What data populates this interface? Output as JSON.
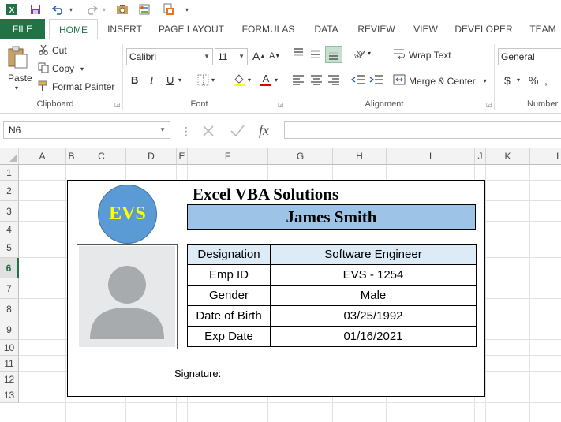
{
  "ribbon_tabs": [
    "FILE",
    "HOME",
    "INSERT",
    "PAGE LAYOUT",
    "FORMULAS",
    "DATA",
    "REVIEW",
    "VIEW",
    "DEVELOPER",
    "TEAM"
  ],
  "ribbon": {
    "clipboard": {
      "paste": "Paste",
      "cut": "Cut",
      "copy": "Copy",
      "format_painter": "Format Painter",
      "label": "Clipboard"
    },
    "font": {
      "name": "Calibri",
      "size": "11",
      "bold": "B",
      "italic": "I",
      "underline": "U",
      "label": "Font"
    },
    "alignment": {
      "wrap_text": "Wrap Text",
      "merge_center": "Merge & Center",
      "label": "Alignment"
    },
    "number": {
      "format": "General",
      "currency": "$",
      "percent": "%",
      "label": "Number"
    }
  },
  "formula_bar": {
    "name_box": "N6",
    "fx": "fx",
    "formula": ""
  },
  "columns": [
    "A",
    "B",
    "C",
    "D",
    "E",
    "F",
    "G",
    "H",
    "I",
    "J",
    "K",
    "L"
  ],
  "rows": [
    "1",
    "2",
    "3",
    "4",
    "5",
    "6",
    "7",
    "8",
    "9",
    "10",
    "11",
    "12",
    "13"
  ],
  "selected_row": "6",
  "card": {
    "logo_text": "EVS",
    "company": "Excel VBA Solutions",
    "employee_name": "James Smith",
    "fields": [
      {
        "label": "Designation",
        "value": "Software Engineer"
      },
      {
        "label": "Emp ID",
        "value": "EVS - 1254"
      },
      {
        "label": "Gender",
        "value": "Male"
      },
      {
        "label": "Date of Birth",
        "value": "03/25/1992"
      },
      {
        "label": "Exp Date",
        "value": "01/16/2021"
      }
    ],
    "signature_label": "Signature:"
  },
  "colors": {
    "excel_green": "#217346",
    "logo_fill": "#5b9bd5",
    "logo_text": "#ffff00",
    "name_banner": "#9dc3e6",
    "designation_row": "#ddebf7"
  }
}
